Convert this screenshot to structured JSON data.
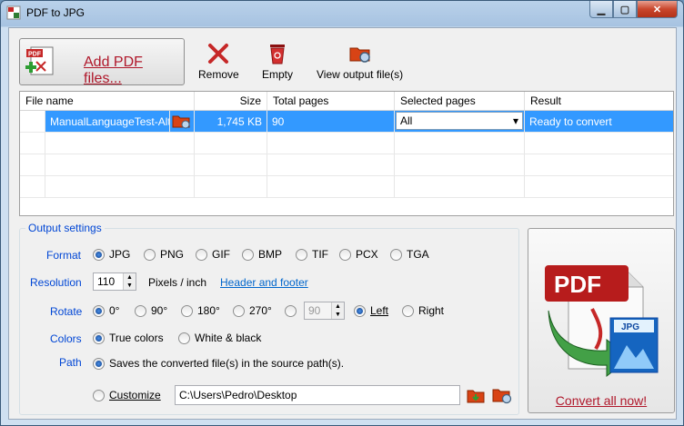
{
  "window": {
    "title": "PDF to JPG"
  },
  "toolbar": {
    "add_label": "Add PDF files...",
    "remove_label": "Remove",
    "empty_label": "Empty",
    "view_output_label": "View output file(s)"
  },
  "grid": {
    "columns": [
      "File name",
      "Size",
      "Total pages",
      "Selected pages",
      "Result"
    ],
    "rows": [
      {
        "file": "ManualLanguageTest-Alt",
        "size": "1,745 KB",
        "pages": "90",
        "selected": "All",
        "result": "Ready to convert"
      }
    ]
  },
  "output": {
    "legend": "Output settings",
    "format_label": "Format",
    "formats": [
      "JPG",
      "PNG",
      "GIF",
      "BMP",
      "TIF",
      "PCX",
      "TGA"
    ],
    "resolution_label": "Resolution",
    "resolution_value": "110",
    "pixels_label": "Pixels / inch",
    "header_footer_link": "Header and footer",
    "rotate_label": "Rotate",
    "rotations": [
      "0°",
      "90°",
      "180°",
      "270°"
    ],
    "rotate_custom": "90",
    "left_label": "Left",
    "right_label": "Right",
    "colors_label": "Colors",
    "true_colors": "True colors",
    "white_black": "White & black",
    "path_label": "Path",
    "path_source": "Saves the converted file(s) in the source path(s).",
    "customize_label": "Customize",
    "custom_path": "C:\\Users\\Pedro\\Desktop"
  },
  "convert": {
    "label": "Convert all now!",
    "pdf_text": "PDF",
    "jpg_text": "JPG"
  },
  "colors": {
    "accent": "#b0182b",
    "selection": "#3399ff",
    "label_blue": "#0046d5"
  }
}
